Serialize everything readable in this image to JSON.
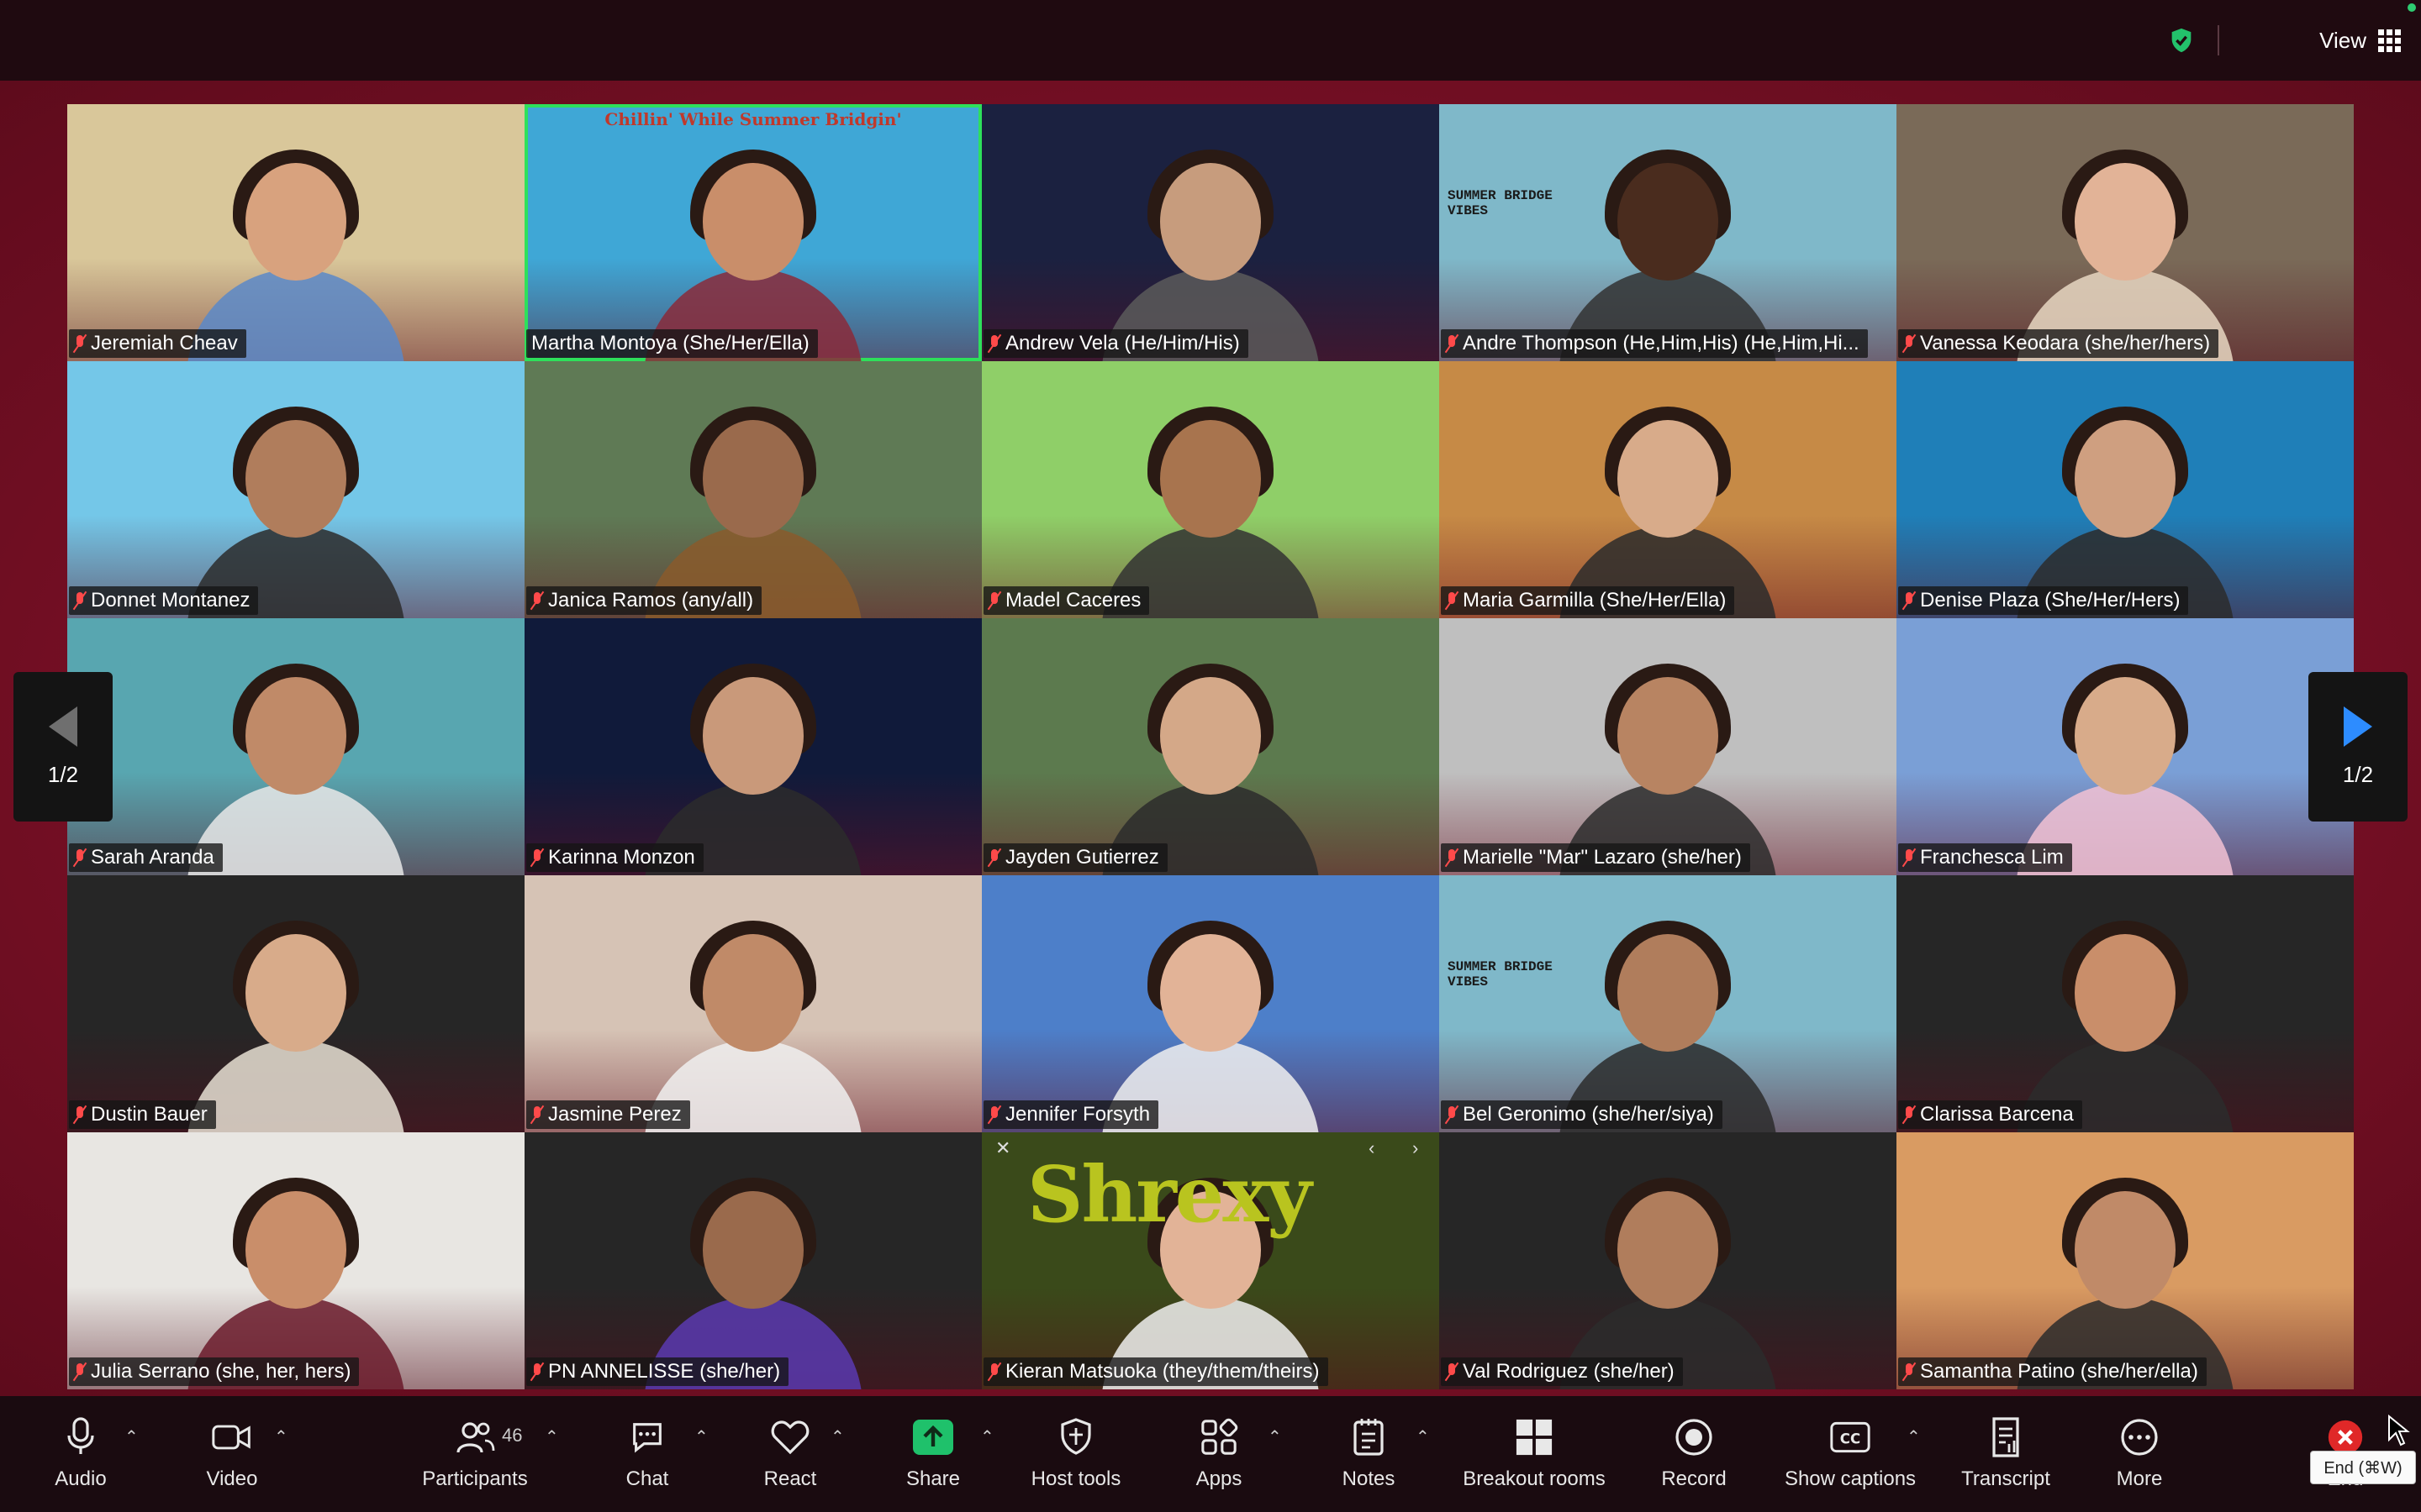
{
  "topbar": {
    "view_label": "View",
    "security_icon": "shield-check-icon"
  },
  "gallery": {
    "page_prev": "1/2",
    "page_next": "1/2",
    "participants": [
      {
        "name": "Jeremiah Cheav",
        "bg": "#d9c79a",
        "skin": "#d8a27e",
        "shirt": "#5a88c8"
      },
      {
        "name": "Martha Montoya (She/Her/Ella)",
        "bg": "#3fa7d6",
        "skin": "#c98e6a",
        "shirt": "#8a2a3a",
        "overlay": "Chillin' While Summer Bridgin'"
      },
      {
        "name": "Andrew Vela (He/Him/His)",
        "bg": "#1b2140",
        "skin": "#c79c7d",
        "shirt": "#5a5a5a"
      },
      {
        "name": "Andre Thompson (He,Him,His) (He,Him,Hi...",
        "bg": "#7fb8c9",
        "skin": "#4a2c1e",
        "shirt": "#333333",
        "overlay": "SUMMER BRIDGE VIBES"
      },
      {
        "name": "Vanessa Keodara (she/her/hers)",
        "bg": "#7a6a58",
        "skin": "#e2b397",
        "shirt": "#e8d7c2"
      },
      {
        "name": "Donnet Montanez",
        "bg": "#74c7e8",
        "skin": "#b07d5c",
        "shirt": "#2c2c2c"
      },
      {
        "name": "Janica Ramos (any/all)",
        "bg": "#5f7a55",
        "skin": "#9a6a4c",
        "shirt": "#8a5a2c"
      },
      {
        "name": "Madel Caceres",
        "bg": "#8fcf68",
        "skin": "#a8744e",
        "shirt": "#333333"
      },
      {
        "name": "Maria Garmilla (She/Her/Ella)",
        "bg": "#c68a46",
        "skin": "#d8ab8a",
        "shirt": "#2c2c2c"
      },
      {
        "name": "Denise Plaza (She/Her/Hers)",
        "bg": "#1f7fb8",
        "skin": "#cf9f80",
        "shirt": "#2c2c2c"
      },
      {
        "name": "Sarah Aranda",
        "bg": "#58a6b0",
        "skin": "#c08a68",
        "shirt": "#e8e8e8"
      },
      {
        "name": "Karinna Monzon",
        "bg": "#101a3a",
        "skin": "#c9997a",
        "shirt": "#2c2c2c"
      },
      {
        "name": "Jayden Gutierrez",
        "bg": "#5c7a4e",
        "skin": "#d4a888",
        "shirt": "#2c2c2c"
      },
      {
        "name": "Marielle \"Mar\" Lazaro (she/her)",
        "bg": "#bfbfbf",
        "skin": "#b88462",
        "shirt": "#2c2c2c"
      },
      {
        "name": "Franchesca Lim",
        "bg": "#7a9fd6",
        "skin": "#d8ab8a",
        "shirt": "#f2c2d4"
      },
      {
        "name": "Dustin Bauer",
        "bg": "#262626",
        "skin": "#d8ab8a",
        "shirt": "#e8e0d4"
      },
      {
        "name": "Jasmine Perez",
        "bg": "#d6c3b5",
        "skin": "#c08a68",
        "shirt": "#f0f0f0"
      },
      {
        "name": "Jennifer Forsyth",
        "bg": "#4d7fc9",
        "skin": "#e2b397",
        "shirt": "#f0f0f0"
      },
      {
        "name": "Bel Geronimo (she/her/siya)",
        "bg": "#7fb8c9",
        "skin": "#b07d5c",
        "shirt": "#2c2c2c",
        "overlay": "SUMMER BRIDGE VIBES"
      },
      {
        "name": "Clarissa Barcena",
        "bg": "#262626",
        "skin": "#c98e6a",
        "shirt": "#2c2c2c"
      },
      {
        "name": "Julia Serrano (she, her, hers)",
        "bg": "#e8e6e2",
        "skin": "#c98e6a",
        "shirt": "#6a1a2a"
      },
      {
        "name": "PN ANNELISSE (she/her)",
        "bg": "#262626",
        "skin": "#9a6a4c",
        "shirt": "#5a3ab0"
      },
      {
        "name": "Kieran Matsuoka (they/them/theirs)",
        "bg": "#3a4a1a",
        "skin": "#e2b397",
        "shirt": "#f0f0f0",
        "overlay": "Shrexy"
      },
      {
        "name": "Val Rodriguez (she/her)",
        "bg": "#262626",
        "skin": "#b07d5c",
        "shirt": "#2c2c2c"
      },
      {
        "name": "Samantha Patino (she/her/ella)",
        "bg": "#d99b62",
        "skin": "#c08a68",
        "shirt": "#2c2c2c"
      }
    ]
  },
  "toolbar": {
    "audio": "Audio",
    "video": "Video",
    "participants": "Participants",
    "participants_count": "46",
    "chat": "Chat",
    "react": "React",
    "share": "Share",
    "host_tools": "Host tools",
    "apps": "Apps",
    "notes": "Notes",
    "breakout_rooms": "Breakout rooms",
    "record": "Record",
    "show_captions": "Show captions",
    "transcript": "Transcript",
    "more": "More",
    "end": "End",
    "end_tooltip": "End (⌘W)",
    "share_color": "#1fc16b",
    "end_color": "#e02828"
  }
}
